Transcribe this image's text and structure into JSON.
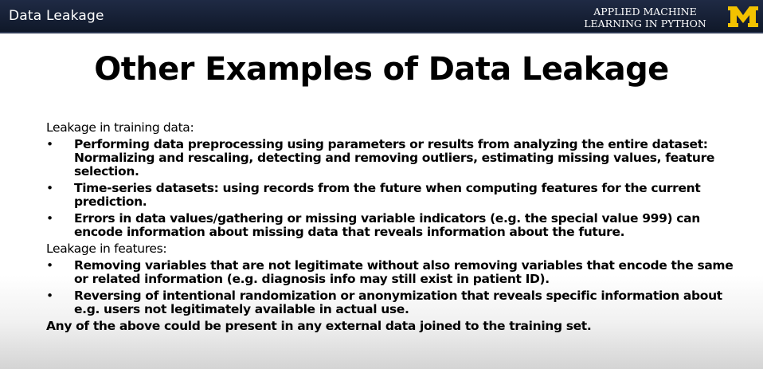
{
  "header": {
    "section_title": "Data Leakage",
    "brand_line1": "APPLIED MACHINE",
    "brand_line2": "LEARNING IN PYTHON",
    "logo_letter": "M",
    "colors": {
      "bar": "#1b2540",
      "logo": "#f2c200"
    }
  },
  "slide": {
    "title": "Other Examples of Data Leakage",
    "sections": [
      {
        "heading": "Leakage in training data:",
        "bullets": [
          "Performing data preprocessing using parameters or results from analyzing the entire dataset: Normalizing and rescaling, detecting and removing outliers, estimating missing values, feature selection.",
          "Time-series datasets: using records from the future when computing features for the current prediction.",
          "Errors in data values/gathering or missing variable indicators (e.g. the special value 999) can encode information about missing data that reveals information about the future."
        ]
      },
      {
        "heading": "Leakage in features:",
        "bullets": [
          "Removing variables that are not legitimate without also removing variables that encode the same or related information (e.g. diagnosis info may still exist in patient ID).",
          "Reversing of intentional randomization or anonymization that reveals specific information about e.g. users not legitimately available in actual use."
        ]
      }
    ],
    "closing": "Any of the above could be present in any external data joined to the training set.",
    "bullet_glyph": "•"
  }
}
